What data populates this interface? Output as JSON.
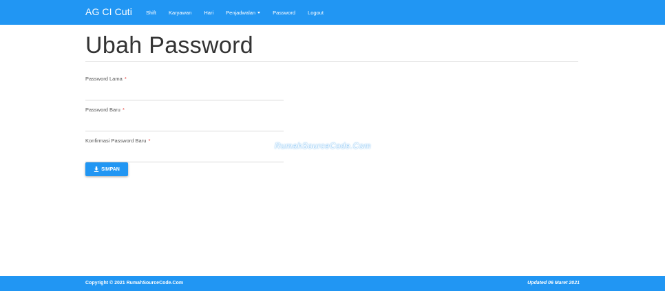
{
  "navbar": {
    "brand": "AG CI Cuti",
    "items": [
      {
        "label": "Shift"
      },
      {
        "label": "Karyawan"
      },
      {
        "label": "Hari"
      },
      {
        "label": "Penjadwalan"
      },
      {
        "label": "Password"
      },
      {
        "label": "Logout"
      }
    ]
  },
  "page": {
    "title": "Ubah Password"
  },
  "form": {
    "required_marker": "*",
    "old_password": {
      "label": "Password Lama",
      "value": ""
    },
    "new_password": {
      "label": "Password Baru",
      "value": ""
    },
    "confirm_password": {
      "label": "Konfirmasi Password Baru",
      "value": ""
    },
    "save_label": "SIMPAN",
    "save_icon": "download-icon"
  },
  "watermark": "RumahSourceCode.Com",
  "footer": {
    "copyright": "Copyright © 2021 RumahSourceCode.Com",
    "updated": "Updated 06 Maret 2021"
  },
  "colors": {
    "primary": "#2196f3",
    "required": "#e53935"
  }
}
